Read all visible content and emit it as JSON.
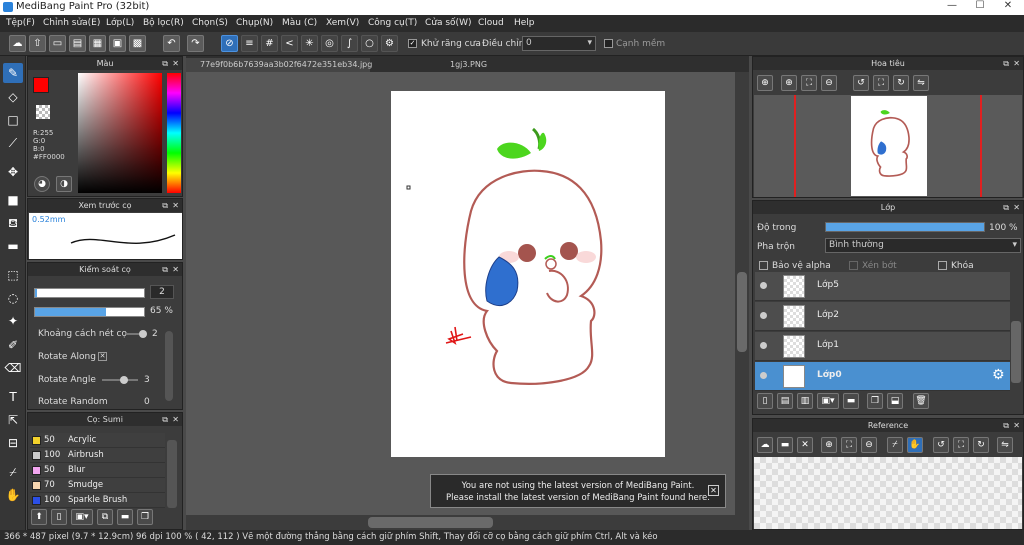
{
  "window": {
    "title": "MediBang Paint Pro (32bit)"
  },
  "menu": [
    "Tệp(F)",
    "Chỉnh sửa(E)",
    "Lớp(L)",
    "Bộ lọc(R)",
    "Chọn(S)",
    "Chụp(N)",
    "Màu (C)",
    "Xem(V)",
    "Công cụ(T)",
    "Cửa số(W)",
    "Cloud",
    "Help"
  ],
  "toolbar": {
    "antialias_label": "Khử răng cưa",
    "adjust_label": "Điều chỉnh",
    "adjust_value": "0",
    "edge_label": "Cạnh mềm"
  },
  "tabs": [
    "77e9f0b6b7639aa3b02f6472e351eb34.jpg",
    "1gj3.PNG"
  ],
  "color_panel": {
    "title": "Màu",
    "r": "R:255",
    "g": "G:0",
    "b": "B:0",
    "hex": "#FF0000",
    "fg_color": "#FF0000"
  },
  "preview_panel": {
    "title": "Xem trước cọ",
    "size": "0.52mm"
  },
  "brush_control": {
    "title": "Kiểm soát cọ",
    "size_value": "2",
    "size_fraction": 0.02,
    "opacity_value": "65 %",
    "opacity_fraction": 0.65,
    "spacing_label": "Khoảng cách nét cọ",
    "spacing_value": "2",
    "spacing_fraction": 0.85,
    "rotate_along_label": "Rotate Along",
    "rotate_angle_label": "Rotate Angle",
    "rotate_angle_value": "3",
    "rotate_angle_fraction": 0.6,
    "rotate_random_label": "Rotate Random",
    "rotate_random_value": "0"
  },
  "brush_list": {
    "title": "Cọ: Sumi",
    "items": [
      {
        "size": "50",
        "name": "Acrylic",
        "color": "#f4d22b"
      },
      {
        "size": "100",
        "name": "Airbrush",
        "color": "#cccccc"
      },
      {
        "size": "50",
        "name": "Blur",
        "color": "#f3a6f0"
      },
      {
        "size": "70",
        "name": "Smudge",
        "color": "#f7d6b0"
      },
      {
        "size": "100",
        "name": "Sparkle Brush",
        "color": "#2b4fe6"
      }
    ]
  },
  "navigator": {
    "title": "Hoa tiêu"
  },
  "layer_panel": {
    "title": "Lớp",
    "opacity_label": "Độ trong",
    "opacity_value": "100 %",
    "opacity_fraction": 1.0,
    "blend_label": "Pha trộn",
    "blend_value": "Bình thường",
    "protect_alpha": "Bảo vệ alpha",
    "clipping": "Xén bớt",
    "lock": "Khóa",
    "layers": [
      {
        "name": "Lớp5",
        "selected": false
      },
      {
        "name": "Lớp2",
        "selected": false
      },
      {
        "name": "Lớp1",
        "selected": false
      },
      {
        "name": "Lớp0",
        "selected": true
      }
    ]
  },
  "reference_panel": {
    "title": "Reference"
  },
  "notice": {
    "line1": "You are not using the latest version of MediBang Paint.",
    "line2": "Please install the latest version of MediBang Paint found here."
  },
  "status": {
    "text": "366 * 487 pixel   (9.7 * 12.9cm)   96 dpi   100 %   ( 42, 112 )   Vẽ một đường thẳng bằng cách giữ phím Shift, Thay đổi cỡ cọ bằng cách giữ phím Ctrl, Alt và kéo"
  },
  "icons": [
    "brush-icon",
    "eraser-icon",
    "rect-select-icon",
    "pen-icon",
    "move-icon",
    "fill-rect-icon",
    "bucket-icon",
    "gradient-icon",
    "marquee-icon",
    "lasso-icon",
    "magic-wand-icon",
    "select-pen-icon",
    "select-eraser-icon",
    "text-icon",
    "operation-icon",
    "divide-icon",
    "eyedropper-icon",
    "hand-icon"
  ]
}
